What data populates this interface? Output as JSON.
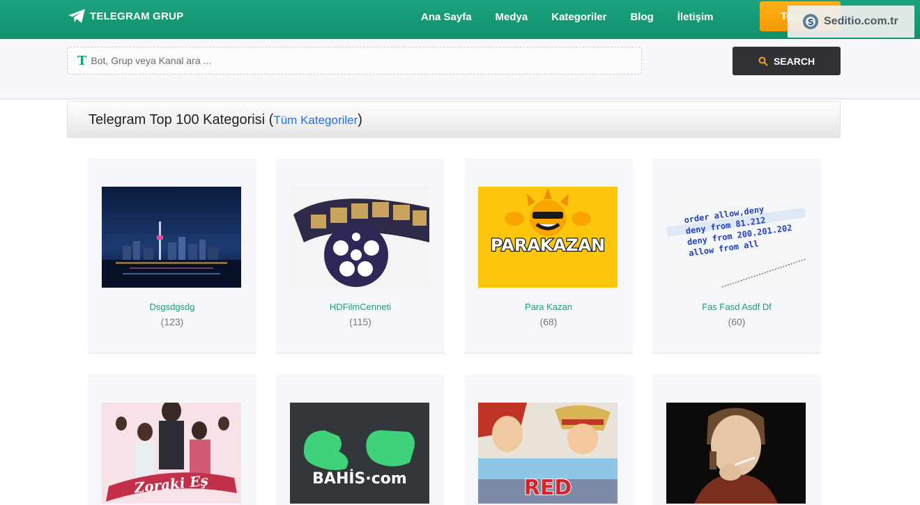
{
  "header": {
    "brand": "TELEGRAM GRUP",
    "nav": [
      "Ana Sayfa",
      "Medya",
      "Kategoriler",
      "Blog",
      "İletişim"
    ],
    "top_button": "Top",
    "watermark": "Seditio.com.tr"
  },
  "search": {
    "placeholder": "Bot, Grup veya Kanal ara ...",
    "button_label": "SEARCH"
  },
  "section": {
    "title": "Telegram Top 100 Kategorisi",
    "link": "Tüm Kategoriler"
  },
  "cards": [
    {
      "name": "Dsgsdgsdg",
      "count": "(123)",
      "image": "city-night-skyline"
    },
    {
      "name": "HDFilmCenneti",
      "count": "(115)",
      "image": "film-reel"
    },
    {
      "name": "Para Kazan",
      "count": "(68)",
      "image": "parakazan-logo",
      "image_text": "PARAKAZAN"
    },
    {
      "name": "Fas Fasd Asdf Df",
      "count": "(60)",
      "image": "code-text",
      "code_lines": [
        "order allow,deny",
        "deny from 81.212",
        "deny from 200.201.202",
        "allow from all"
      ]
    },
    {
      "name": "",
      "count": "",
      "image": "drama-poster",
      "image_text": "Zoraki Eş"
    },
    {
      "name": "",
      "count": "",
      "image": "bahis-logo",
      "image_text": "BAHİS·com"
    },
    {
      "name": "",
      "count": "",
      "image": "anime-poster",
      "image_text": "RED"
    },
    {
      "name": "",
      "count": "",
      "image": "portrait-smoking"
    }
  ],
  "colors": {
    "header_green": "#138f6c",
    "accent_orange": "#f39a00",
    "link_blue": "#1a73e8",
    "card_name_green": "#1f9a74"
  }
}
